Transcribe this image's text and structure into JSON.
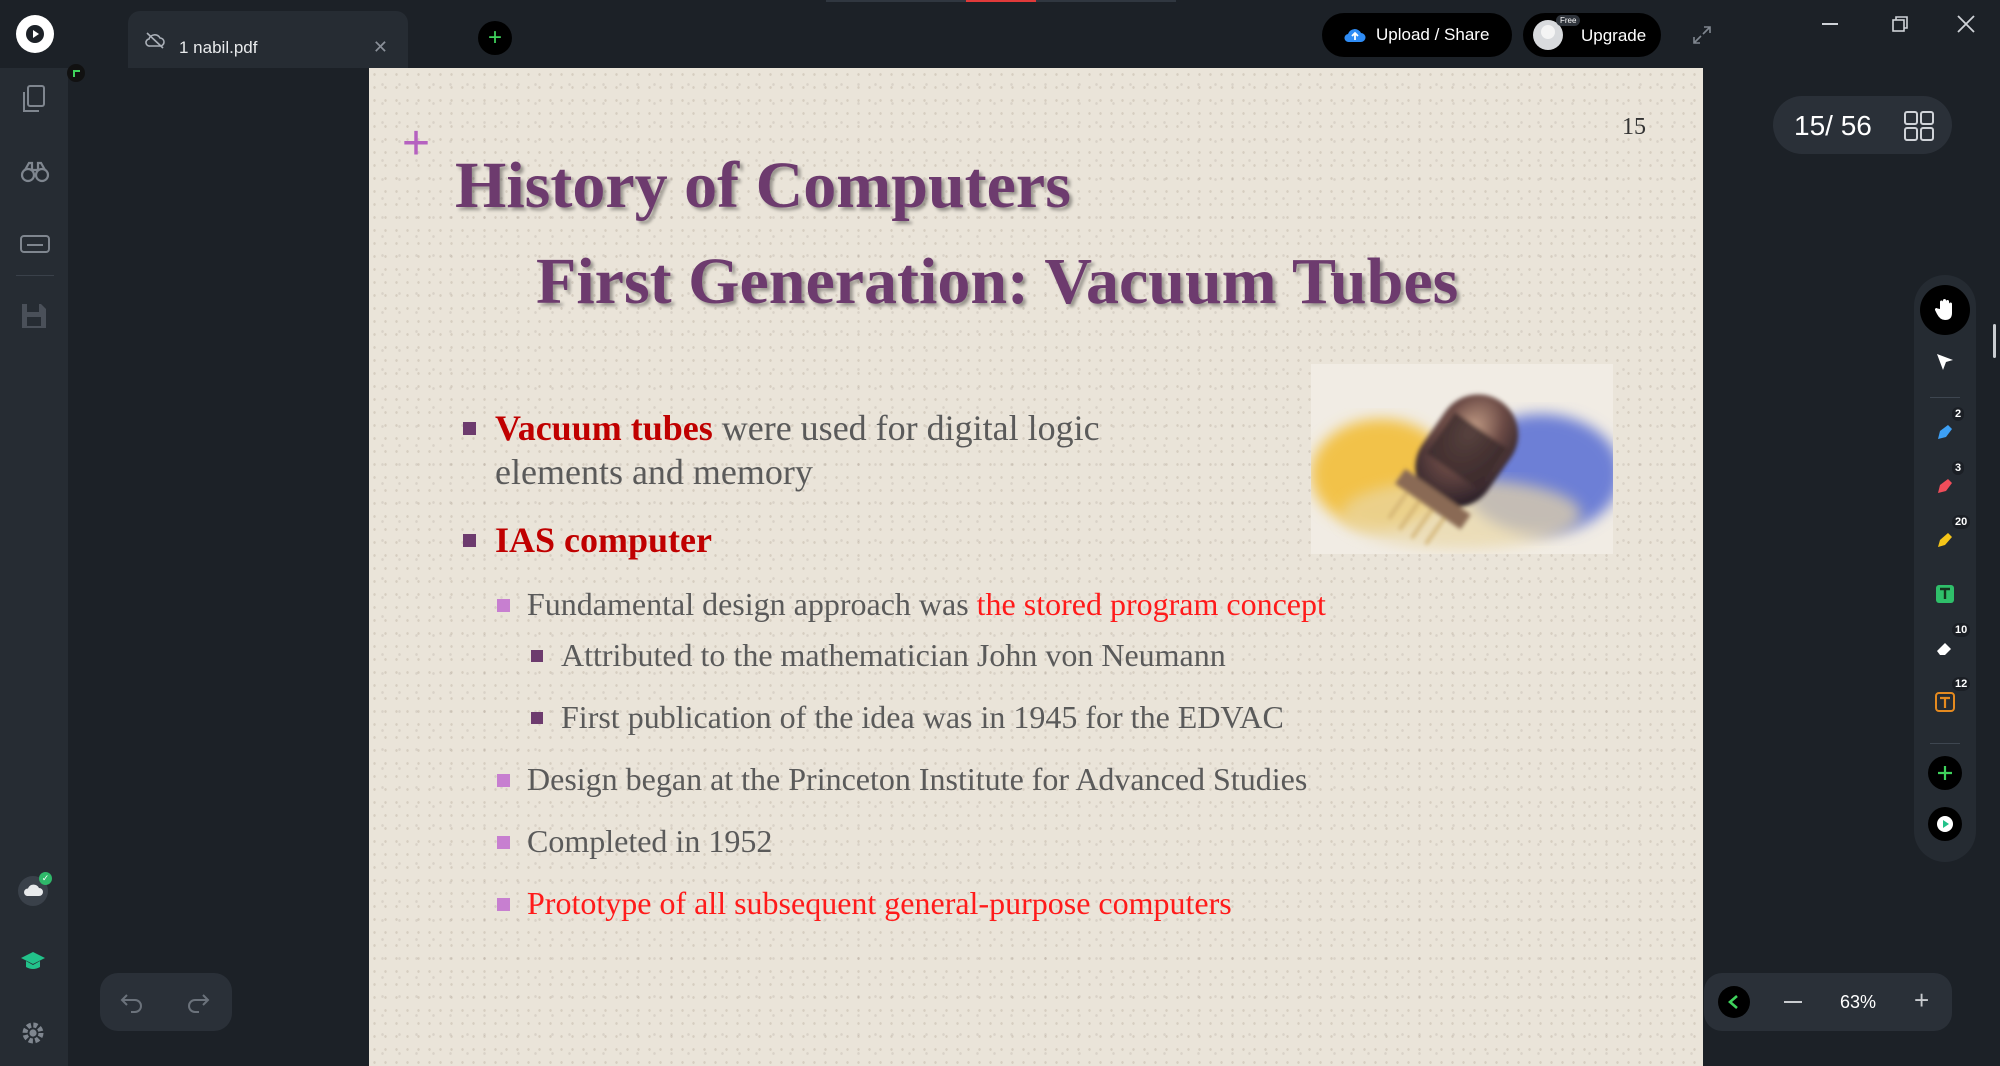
{
  "window": {
    "tab_title": "1 nabil.pdf",
    "upload_label": "Upload / Share",
    "upgrade_label": "Upgrade",
    "free_tag": "Free"
  },
  "viewer": {
    "page_indicator": "15/ 56",
    "zoom_level": "63%",
    "tool_badges": {
      "blue_pen": "2",
      "red_pen": "3",
      "highlighter": "20",
      "eraser": "10",
      "text_box": "12"
    }
  },
  "slide": {
    "page_number": "15",
    "title": "History of Computers",
    "subtitle": "First Generation:  Vacuum Tubes",
    "bullets": {
      "b1_red": "Vacuum tubes",
      "b1_rest": " were used for digital logic",
      "b1_line2": "elements and memory",
      "b2": "IAS computer",
      "b2_1_plain": "Fundamental design approach was ",
      "b2_1_red": "the stored program concept",
      "b2_1_1": "Attributed to the mathematician John von Neumann",
      "b2_1_2": "First publication of the idea was in 1945 for the EDVAC",
      "b2_2": "Design began at the Princeton Institute for Advanced Studies",
      "b2_3": "Completed in 1952",
      "b2_4": "Prototype of all subsequent general-purpose computers"
    }
  },
  "colors": {
    "app_bg": "#1c2127",
    "panel": "#262c33",
    "accent_green": "#3fd25c",
    "slide_title": "#6d3b6e",
    "slide_red": "#c00000"
  }
}
